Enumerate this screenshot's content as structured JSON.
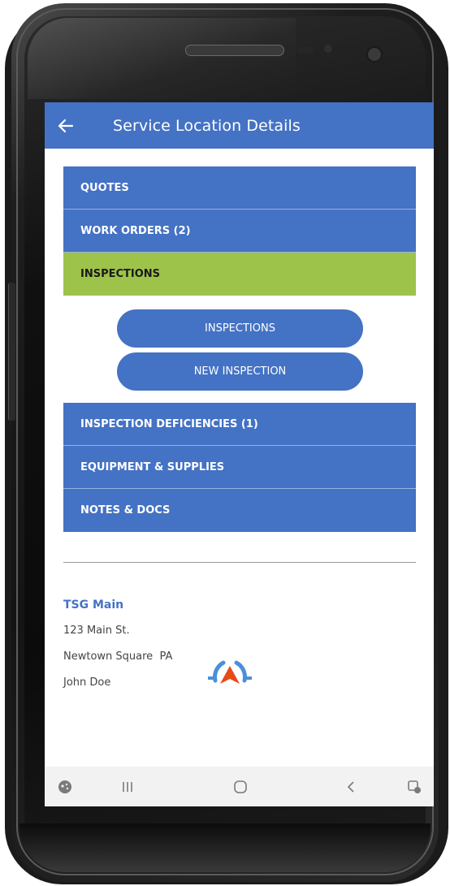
{
  "app_bar": {
    "back_icon": "arrow-left-icon",
    "title": "Service Location Details"
  },
  "menu_top": [
    {
      "label": "QUOTES",
      "active": false
    },
    {
      "label": "WORK ORDERS (2)",
      "active": false
    },
    {
      "label": "INSPECTIONS",
      "active": true
    }
  ],
  "inspection_actions": {
    "inspections_label": "INSPECTIONS",
    "new_inspection_label": "NEW INSPECTION"
  },
  "menu_bottom": [
    {
      "label": "INSPECTION DEFICIENCIES (1)"
    },
    {
      "label": "EQUIPMENT & SUPPLIES"
    },
    {
      "label": "NOTES & DOCS"
    }
  ],
  "location": {
    "name": "TSG Main",
    "street": "123 Main St.",
    "city_state": "Newtown Square  PA",
    "contact": "John Doe"
  },
  "nav_bar": {
    "left_icon": "game-launcher-icon",
    "recents_icon": "recent-apps-icon",
    "home_icon": "home-icon",
    "back_icon": "back-chevron-icon",
    "right_icon": "screenshot-edit-icon"
  },
  "colors": {
    "primary": "#4472c4",
    "active": "#9dc34a",
    "logo_red": "#e64a19",
    "logo_blue": "#4a90d9"
  }
}
